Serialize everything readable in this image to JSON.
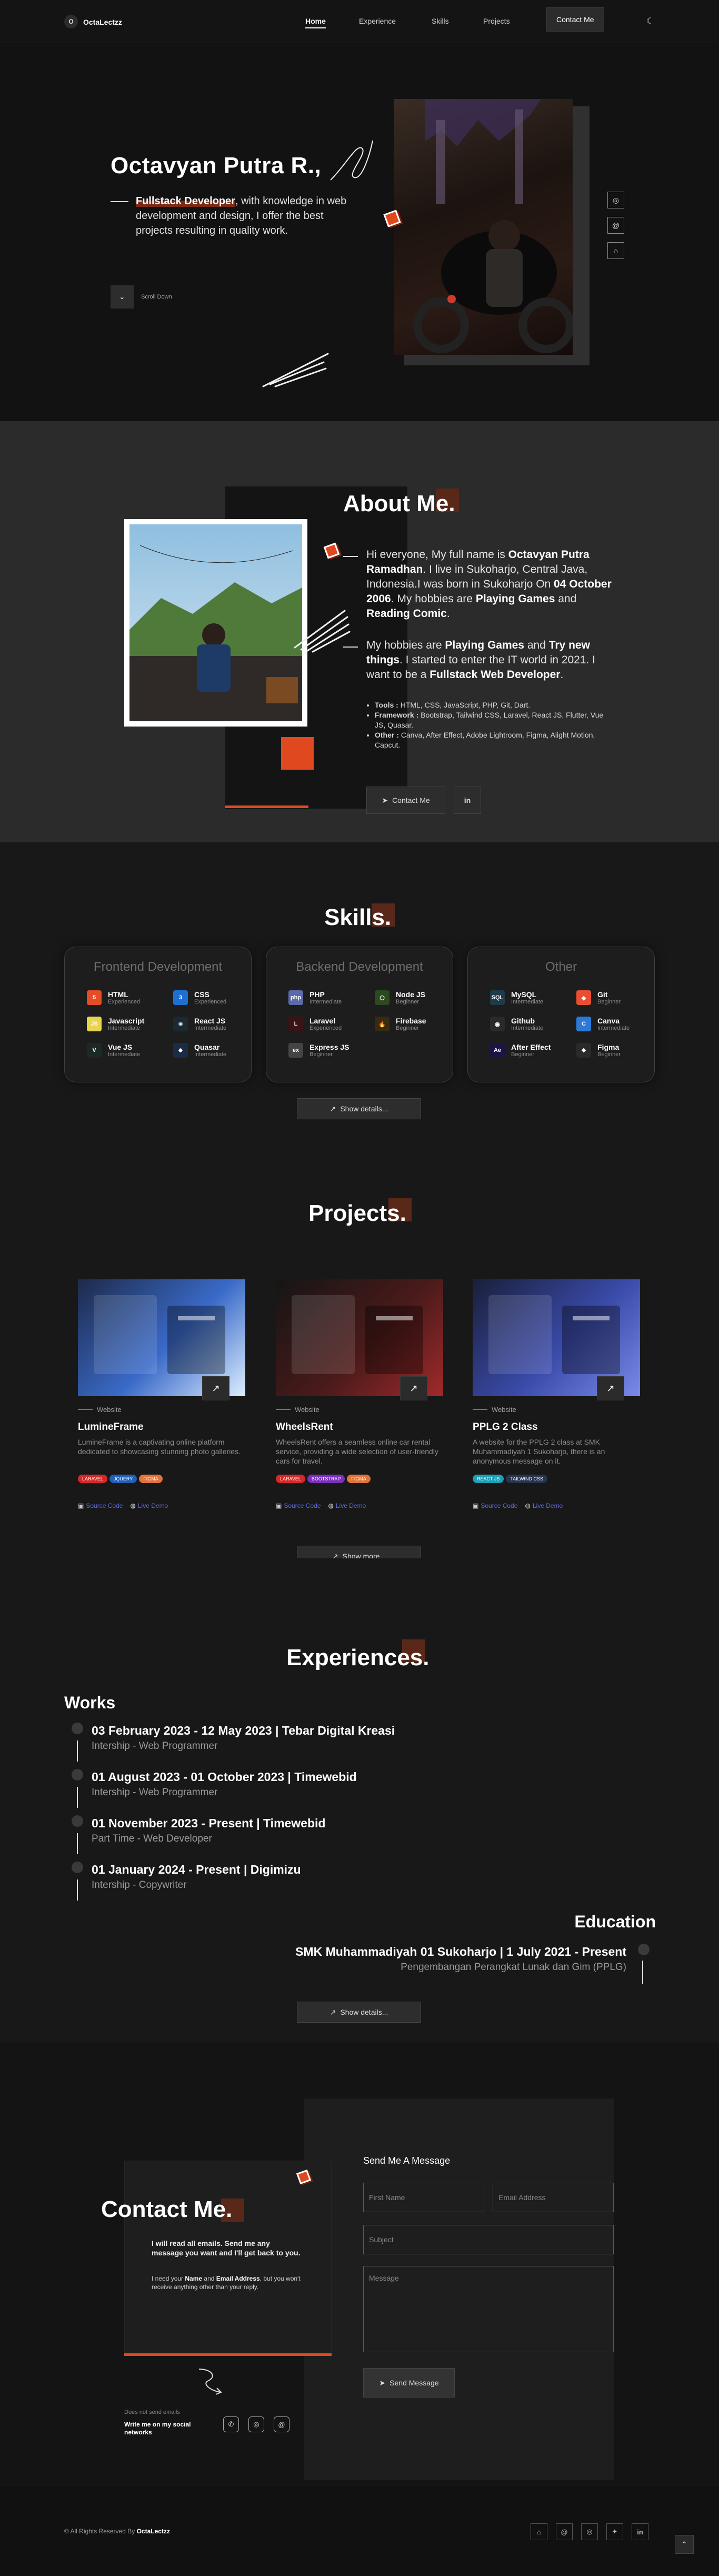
{
  "nav": {
    "brand": "OctaLectzz",
    "brand_initial": "O",
    "links": [
      "Home",
      "Experience",
      "Skills",
      "Projects"
    ],
    "contact_button": "Contact Me",
    "theme_icon": "moon-icon"
  },
  "hero": {
    "name": "Octavyan Putra R.,",
    "role": "Fullstack Developer",
    "tagline": ", with knowledge in web development and design, I offer the best projects resulting in quality work.",
    "scroll_label": "Scroll Down",
    "socials": [
      "instagram-icon",
      "threads-icon",
      "github-icon"
    ]
  },
  "about": {
    "title": "About Me.",
    "p1_a": "Hi everyone, My full name is ",
    "p1_name": "Octavyan Putra Ramadhan",
    "p1_b": ". I live in Sukoharjo, Central Java, Indonesia.I was born in Sukoharjo On ",
    "p1_date": "04 October 2006",
    "p1_c": ". My hobbies are ",
    "p1_h1": "Playing Games",
    "p1_d": " and ",
    "p1_h2": "Reading Comic",
    "p1_e": ".",
    "p2_a": "My hobbies are ",
    "p2_h1": "Playing Games",
    "p2_b": " and ",
    "p2_h2": "Try new things",
    "p2_c": ". I started to enter the IT world in 2021. I want to be a ",
    "p2_h3": "Fullstack Web Developer",
    "p2_d": ".",
    "bullets": [
      {
        "label": "Tools :",
        "text": " HTML, CSS, JavaScript, PHP, Git, Dart."
      },
      {
        "label": "Framework :",
        "text": " Bootstrap, Tailwind CSS, Laravel, React JS, Flutter, Vue JS, Quasar."
      },
      {
        "label": "Other :",
        "text": " Canva, After Effect, Adobe Lightroom, Figma, Alight Motion, Capcut."
      }
    ],
    "contact_button": "Contact Me",
    "linkedin": "in"
  },
  "skills": {
    "title": "Skills.",
    "cards": [
      {
        "title": "Frontend Development",
        "items": [
          {
            "name": "HTML",
            "level": "Experienced",
            "icon": "html5-icon",
            "color": "#e44d26",
            "glyph": "5"
          },
          {
            "name": "CSS",
            "level": "Experienced",
            "icon": "css3-icon",
            "color": "#1f6fd1",
            "glyph": "3"
          },
          {
            "name": "Javascript",
            "level": "Intermediate",
            "icon": "javascript-icon",
            "color": "#e8d44d",
            "glyph": "JS"
          },
          {
            "name": "React JS",
            "level": "Intermediate",
            "icon": "react-icon",
            "color": "#1a2a33",
            "glyph": "⚛"
          },
          {
            "name": "Vue JS",
            "level": "Intermediate",
            "icon": "vue-icon",
            "color": "#1d2a24",
            "glyph": "V"
          },
          {
            "name": "Quasar",
            "level": "Intermediate",
            "icon": "quasar-icon",
            "color": "#1a2b44",
            "glyph": "✸"
          }
        ]
      },
      {
        "title": "Backend Development",
        "items": [
          {
            "name": "PHP",
            "level": "Intermediate",
            "icon": "php-icon",
            "color": "#5b6aa8",
            "glyph": "php"
          },
          {
            "name": "Node JS",
            "level": "Beginner",
            "icon": "nodejs-icon",
            "color": "#2b4a1f",
            "glyph": "⬡"
          },
          {
            "name": "Laravel",
            "level": "Experienced",
            "icon": "laravel-icon",
            "color": "#3a1414",
            "glyph": "L"
          },
          {
            "name": "Firebase",
            "level": "Beginner",
            "icon": "firebase-icon",
            "color": "#3a2a10",
            "glyph": "🔥"
          },
          {
            "name": "Express JS",
            "level": "Beginner",
            "icon": "express-icon",
            "color": "#444",
            "glyph": "ex"
          }
        ]
      },
      {
        "title": "Other",
        "items": [
          {
            "name": "MySQL",
            "level": "Intermediate",
            "icon": "mysql-icon",
            "color": "#1f3a4a",
            "glyph": "SQL"
          },
          {
            "name": "Git",
            "level": "Beginner",
            "icon": "git-icon",
            "color": "#e84e31",
            "glyph": "◆"
          },
          {
            "name": "Github",
            "level": "Intermediate",
            "icon": "github-icon",
            "color": "#2a2a2a",
            "glyph": "◉"
          },
          {
            "name": "Canva",
            "level": "Intermediate",
            "icon": "canva-icon",
            "color": "#2a7ad8",
            "glyph": "C"
          },
          {
            "name": "After Effect",
            "level": "Beginner",
            "icon": "after-effects-icon",
            "color": "#1d1446",
            "glyph": "Ae"
          },
          {
            "name": "Figma",
            "level": "Beginner",
            "icon": "figma-icon",
            "color": "#2a2a2a",
            "glyph": "❖"
          }
        ]
      }
    ],
    "details_button": "Show details..."
  },
  "projects": {
    "title": "Projects.",
    "items": [
      {
        "category": "Website",
        "name": "LumineFrame",
        "desc": "LumineFrame is a captivating online platform dedicated to showcasing stunning photo galleries.",
        "tags": [
          {
            "t": "LARAVEL",
            "c": "#d62828"
          },
          {
            "t": "JQUERY",
            "c": "#1f5fb8"
          },
          {
            "t": "FIGMA",
            "c": "#e0733a"
          }
        ],
        "links": [
          "Source Code",
          "Live Demo"
        ]
      },
      {
        "category": "Website",
        "name": "WheelsRent",
        "desc": "WheelsRent offers a seamless online car rental service, providing a wide selection of user-friendly cars for travel.",
        "tags": [
          {
            "t": "LARAVEL",
            "c": "#d62828"
          },
          {
            "t": "BOOTSTRAP",
            "c": "#7b2fbf"
          },
          {
            "t": "FIGMA",
            "c": "#e0733a"
          }
        ],
        "links": [
          "Source Code",
          "Live Demo"
        ]
      },
      {
        "category": "Website",
        "name": "PPLG 2 Class",
        "desc": "A website for the PPLG 2 class at SMK Muhammadiyah 1 Sukoharjo, there is an anonymous message on it.",
        "tags": [
          {
            "t": "REACT JS",
            "c": "#1aa0b8"
          },
          {
            "t": "TAILWIND CSS",
            "c": "#26344d"
          }
        ],
        "links": [
          "Source Code",
          "Live Demo"
        ]
      }
    ],
    "more_button": "Show more..."
  },
  "experiences": {
    "title": "Experiences.",
    "works_heading": "Works",
    "works": [
      {
        "title": "03 February 2023 - 12 May 2023 | Tebar Digital Kreasi",
        "sub": "Intership - Web Programmer"
      },
      {
        "title": "01 August 2023 - 01 October 2023 | Timewebid",
        "sub": "Intership - Web Programmer"
      },
      {
        "title": "01 November 2023 - Present | Timewebid",
        "sub": "Part Time - Web Developer"
      },
      {
        "title": "01 January 2024 - Present | Digimizu",
        "sub": "Intership - Copywriter"
      }
    ],
    "education_heading": "Education",
    "education": [
      {
        "title": "SMK Muhammadiyah 01 Sukoharjo | 1 July 2021 - Present",
        "sub": "Pengembangan Perangkat Lunak dan Gim (PPLG)"
      }
    ],
    "details_button": "Show details..."
  },
  "contact": {
    "title": "Contact Me.",
    "msg1": "I will read all emails. Send me any message you want and I'll get back to you.",
    "msg2_a": "I need your ",
    "msg2_b": "Name",
    "msg2_c": " and ",
    "msg2_d": "Email Address",
    "msg2_e": ", but you won't receive anything other than your reply.",
    "no_email": "Does not send emails",
    "social_cta": "Write me on my social networks",
    "form_title": "Send Me A Message",
    "first_name_placeholder": "First Name",
    "email_placeholder": "Email Address",
    "subject_placeholder": "Subject",
    "message_placeholder": "Message",
    "send_button": "Send Message"
  },
  "footer": {
    "copyright": "© All Rights Reserved By ",
    "brand": "OctaLectzz",
    "icons": [
      "github-icon",
      "threads-icon",
      "instagram-icon",
      "twitter-icon",
      "linkedin-icon"
    ],
    "to_top_icon": "arrow-up-icon"
  },
  "colors": {
    "accent": "#ff5a2c",
    "bg": "#161616",
    "link": "#5b6bd8"
  }
}
